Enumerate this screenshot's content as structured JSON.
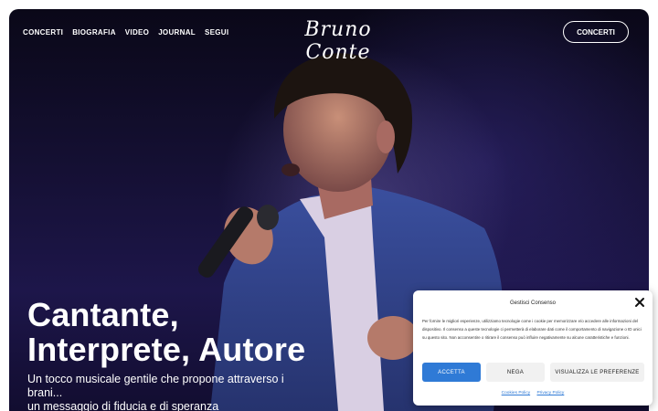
{
  "nav": {
    "items": [
      "CONCERTI",
      "BIOGRAFIA",
      "VIDEO",
      "JOURNAL",
      "SEGUI"
    ],
    "logo": "Bruno Conte",
    "cta": "CONCERTI"
  },
  "hero": {
    "headline_line1": "Cantante,",
    "headline_line2": "Interprete, Autore",
    "sub_line1": "Un tocco musicale gentile che propone attraverso i",
    "sub_line2": "brani...",
    "sub_line3": "un messaggio di fiducia e di speranza"
  },
  "consent": {
    "title": "Gestisci Consenso",
    "text": "Per fornire le migliori esperienze, utilizziamo tecnologie come i cookie per memorizzare e/o accedere alle informazioni del dispositivo. Il consenso a queste tecnologie ci permetterà di elaborare dati come il comportamento di navigazione o ID unici su questo sito. Non acconsentire o ritirare il consenso può influire negativamente su alcune caratteristiche e funzioni.",
    "accept": "ACCETTA",
    "deny": "NEGA",
    "prefs": "VISUALIZZA LE PREFERENZE",
    "cookies_policy": "Cookies Policy",
    "privacy_policy": "Privacy Policy",
    "close_icon": "close-icon"
  },
  "colors": {
    "accent": "#2f7ad6",
    "hero_dark": "#151034"
  }
}
